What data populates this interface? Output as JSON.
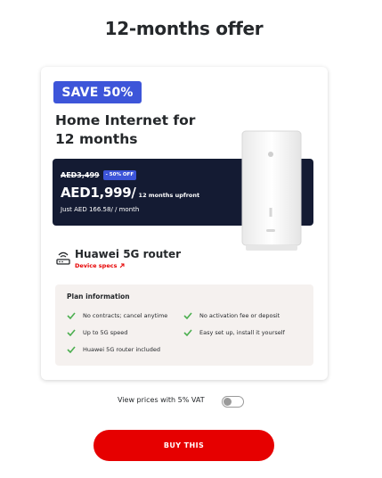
{
  "page": {
    "title": "12-months offer"
  },
  "offer": {
    "badge": "SAVE 50%",
    "title": "Home Internet for 12 months",
    "old_price": "AED3,499",
    "discount_pill": "- 50% OFF",
    "price": "AED1,999/",
    "price_note": "12 months upfront",
    "monthly": "Just AED 166.58/ / month",
    "device_name": "Huawei 5G router",
    "device_specs_link": "Device specs"
  },
  "plan": {
    "title": "Plan information",
    "features": [
      "No contracts; cancel anytime",
      "No activation fee or deposit",
      "Up to 5G speed",
      "Easy set up, install it yourself",
      "Huawei 5G router included"
    ]
  },
  "vat": {
    "label": "View prices with 5% VAT",
    "enabled": false
  },
  "cta": {
    "label": "BUY THIS"
  },
  "colors": {
    "brand_red": "#e60000",
    "badge_blue": "#3d55d9",
    "price_box": "#141b33",
    "check_green": "#4caf50"
  },
  "icons": [
    "wifi-router-icon",
    "external-arrow-icon",
    "check-icon"
  ]
}
